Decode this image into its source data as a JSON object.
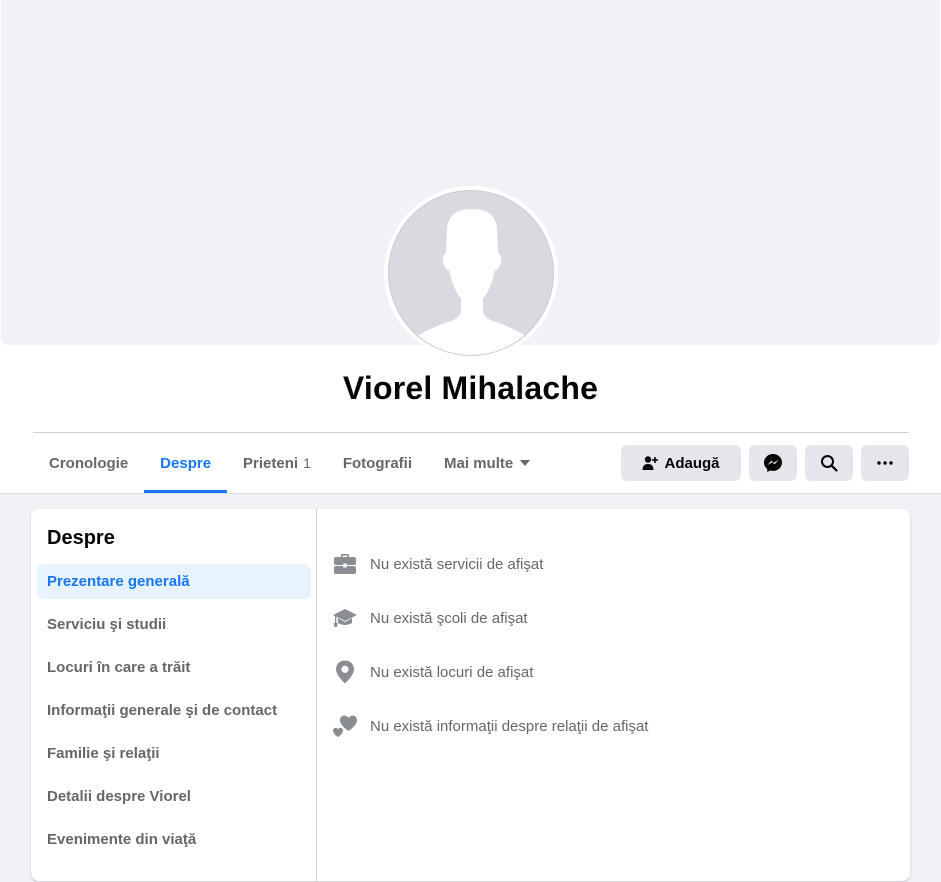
{
  "profile": {
    "name": "Viorel Mihalache"
  },
  "tabs": [
    {
      "label": "Cronologie"
    },
    {
      "label": "Despre"
    },
    {
      "label": "Prieteni",
      "count": "1"
    },
    {
      "label": "Fotografii"
    },
    {
      "label": "Mai multe"
    }
  ],
  "actions": {
    "add_friend_label": "Adaugă",
    "messenger_icon": "messenger-icon",
    "search_icon": "search-icon",
    "more_icon": "more-dots-icon"
  },
  "about": {
    "title": "Despre",
    "sidebar": [
      {
        "label": "Prezentare generală"
      },
      {
        "label": "Serviciu şi studii"
      },
      {
        "label": "Locuri în care a trăit"
      },
      {
        "label": "Informaţii generale şi de contact"
      },
      {
        "label": "Familie şi relaţii"
      },
      {
        "label": "Detalii despre Viorel"
      },
      {
        "label": "Evenimente din viaţă"
      }
    ],
    "overview": [
      {
        "icon": "briefcase-icon",
        "text": "Nu există servicii de afişat"
      },
      {
        "icon": "graduation-cap-icon",
        "text": "Nu există şcoli de afişat"
      },
      {
        "icon": "location-pin-icon",
        "text": "Nu există locuri de afişat"
      },
      {
        "icon": "hearts-icon",
        "text": "Nu există informaţii despre relaţii de afişat"
      }
    ]
  },
  "colors": {
    "accent": "#1877f2",
    "text_secondary": "#65676b",
    "button_bg": "#e4e6eb",
    "active_item_bg": "#e7f3ff"
  }
}
